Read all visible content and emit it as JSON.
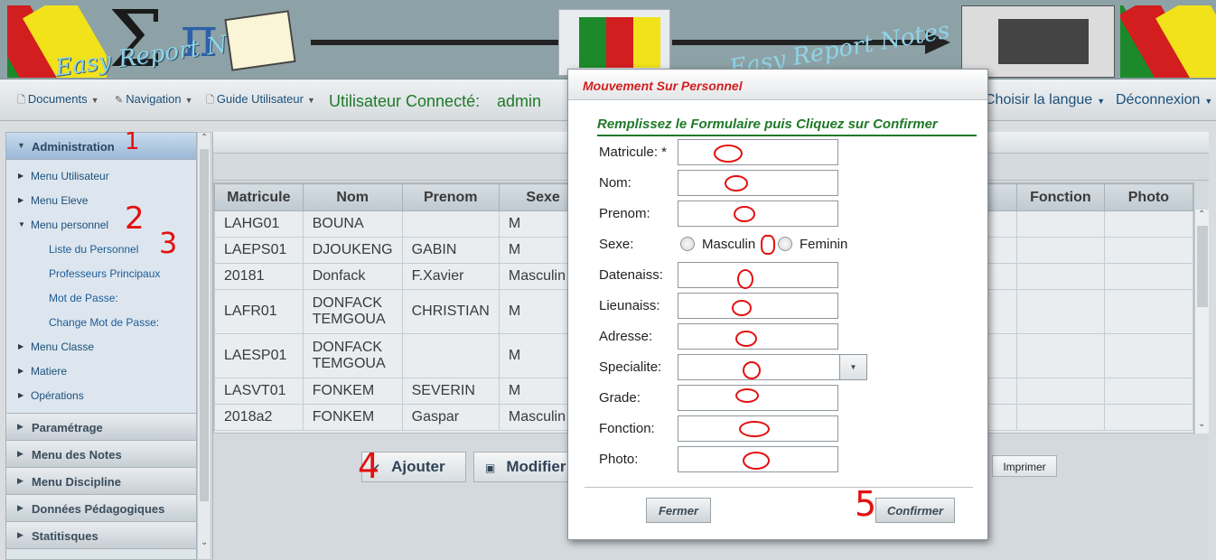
{
  "banner": {
    "logo_text": "Easy Report Notes",
    "logo_text_right": "Easy Report Notes"
  },
  "menubar": {
    "documents": "Documents",
    "navigation": "Navigation",
    "guide": "Guide Utilisateur",
    "user_label": "Utilisateur Connecté:",
    "user_name": "admin",
    "language": "Choisir la langue",
    "logout": "Déconnexion"
  },
  "sidebar": {
    "administration": "Administration",
    "items": [
      "Menu Utilisateur",
      "Menu Eleve",
      "Menu personnel"
    ],
    "sub_items": [
      "Liste du Personnel",
      "Professeurs Principaux",
      "Mot de Passe:",
      "Change Mot de Passe:"
    ],
    "items_after": [
      "Menu Classe",
      "Matiere",
      "Opérations"
    ],
    "sections": [
      "Paramétrage",
      "Menu des Notes",
      "Menu Discipline",
      "Données Pédagogiques",
      "Statitisques"
    ]
  },
  "grid": {
    "columns": [
      "Matricule",
      "Nom",
      "Prenom",
      "Sexe",
      "Fonction",
      "Photo"
    ],
    "rows": [
      {
        "matricule": "LAHG01",
        "nom": "BOUNA",
        "prenom": "",
        "sexe": "M"
      },
      {
        "matricule": "LAEPS01",
        "nom": "DJOUKENG",
        "prenom": "GABIN",
        "sexe": "M"
      },
      {
        "matricule": "20181",
        "nom": "Donfack",
        "prenom": "F.Xavier",
        "sexe": "Masculin"
      },
      {
        "matricule": "LAFR01",
        "nom": "DONFACK TEMGOUA",
        "prenom": "CHRISTIAN",
        "sexe": "M"
      },
      {
        "matricule": "LAESP01",
        "nom": "DONFACK TEMGOUA",
        "prenom": "",
        "sexe": "M"
      },
      {
        "matricule": "LASVT01",
        "nom": "FONKEM",
        "prenom": "SEVERIN",
        "sexe": "M"
      },
      {
        "matricule": "2018a2",
        "nom": "FONKEM",
        "prenom": "Gaspar",
        "sexe": "Masculin"
      }
    ]
  },
  "actions": {
    "add": "Ajouter",
    "edit": "Modifier",
    "print": "Imprimer"
  },
  "modal": {
    "title": "Mouvement Sur Personnel",
    "heading": "Remplissez le Formulaire puis Cliquez sur Confirmer",
    "fields": {
      "matricule": "Matricule: *",
      "nom": "Nom:",
      "prenom": "Prenom:",
      "sexe": "Sexe:",
      "datenaiss": "Datenaiss:",
      "lieunaiss": "Lieunaiss:",
      "adresse": "Adresse:",
      "specialite": "Specialite:",
      "grade": "Grade:",
      "fonction": "Fonction:",
      "photo": "Photo:"
    },
    "sexe_options": [
      "Masculin",
      "Feminin"
    ],
    "close": "Fermer",
    "confirm": "Confirmer"
  },
  "annotations": [
    "1",
    "2",
    "3",
    "4",
    "5"
  ],
  "colors": {
    "accent_green": "#1f7a28",
    "title_red": "#d12020",
    "annotation_red": "#e3100f",
    "link_blue": "#1b4f7a"
  }
}
